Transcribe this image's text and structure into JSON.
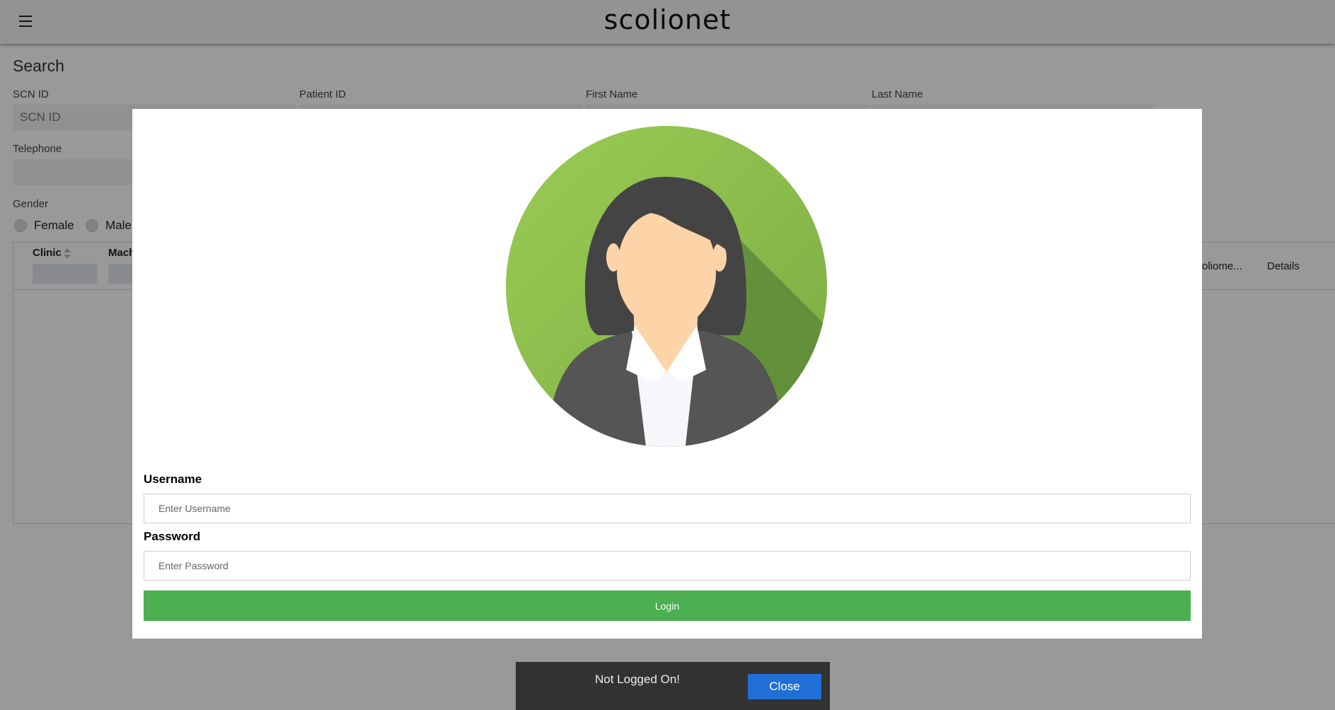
{
  "app": {
    "title": "scolionet"
  },
  "search": {
    "heading": "Search",
    "fields": {
      "scn_id": {
        "label": "SCN ID",
        "placeholder": "SCN ID"
      },
      "patient_id": {
        "label": "Patient ID"
      },
      "first_name": {
        "label": "First Name"
      },
      "last_name": {
        "label": "Last Name"
      },
      "telephone": {
        "label": "Telephone"
      }
    },
    "gender": {
      "label": "Gender",
      "options": [
        "Female",
        "Male"
      ]
    }
  },
  "table": {
    "columns": {
      "clinic": "Clinic",
      "machine": "Mach",
      "scoliometer": "oliome...",
      "details": "Details"
    }
  },
  "login": {
    "username_label": "Username",
    "username_placeholder": "Enter Username",
    "password_label": "Password",
    "password_placeholder": "Enter Password",
    "login_button": "Login"
  },
  "snackbar": {
    "message": "Not Logged On!",
    "close_button": "Close",
    "close_color": "#1f6fd6"
  },
  "colors": {
    "login_green": "#4caf50",
    "avatar_green": "#8bc34a"
  }
}
